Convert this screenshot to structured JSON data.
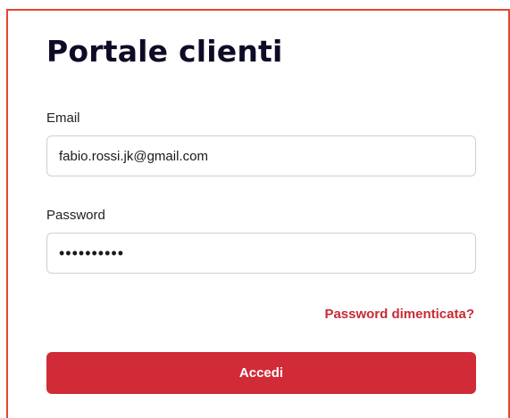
{
  "page": {
    "title": "Portale clienti"
  },
  "form": {
    "email_label": "Email",
    "email_value": "fabio.rossi.jk@gmail.com",
    "password_label": "Password",
    "password_value": "••••••••••",
    "forgot_link": "Password dimenticata?",
    "submit_label": "Accedi"
  },
  "colors": {
    "accent": "#d12b38",
    "link": "#c92a35",
    "frame_border": "#e8442f",
    "title": "#0d0b26"
  }
}
